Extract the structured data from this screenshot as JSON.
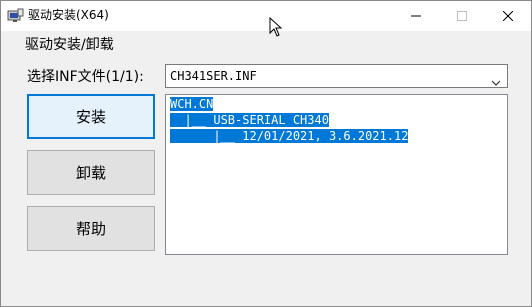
{
  "window": {
    "title": "驱动安装(X64)"
  },
  "group": {
    "label": "驱动安装/卸载"
  },
  "inf_select": {
    "label": "选择INF文件(1/1):",
    "value": "CH341SER.INF"
  },
  "buttons": {
    "install": "安装",
    "uninstall": "卸载",
    "help": "帮助"
  },
  "tree": {
    "lines": [
      "WCH.CN",
      "  |__ USB-SERIAL CH340",
      "      |__ 12/01/2021, 3.6.2021.12"
    ]
  },
  "colors": {
    "selection": "#0078d7",
    "default_button_border": "#0078d7"
  }
}
